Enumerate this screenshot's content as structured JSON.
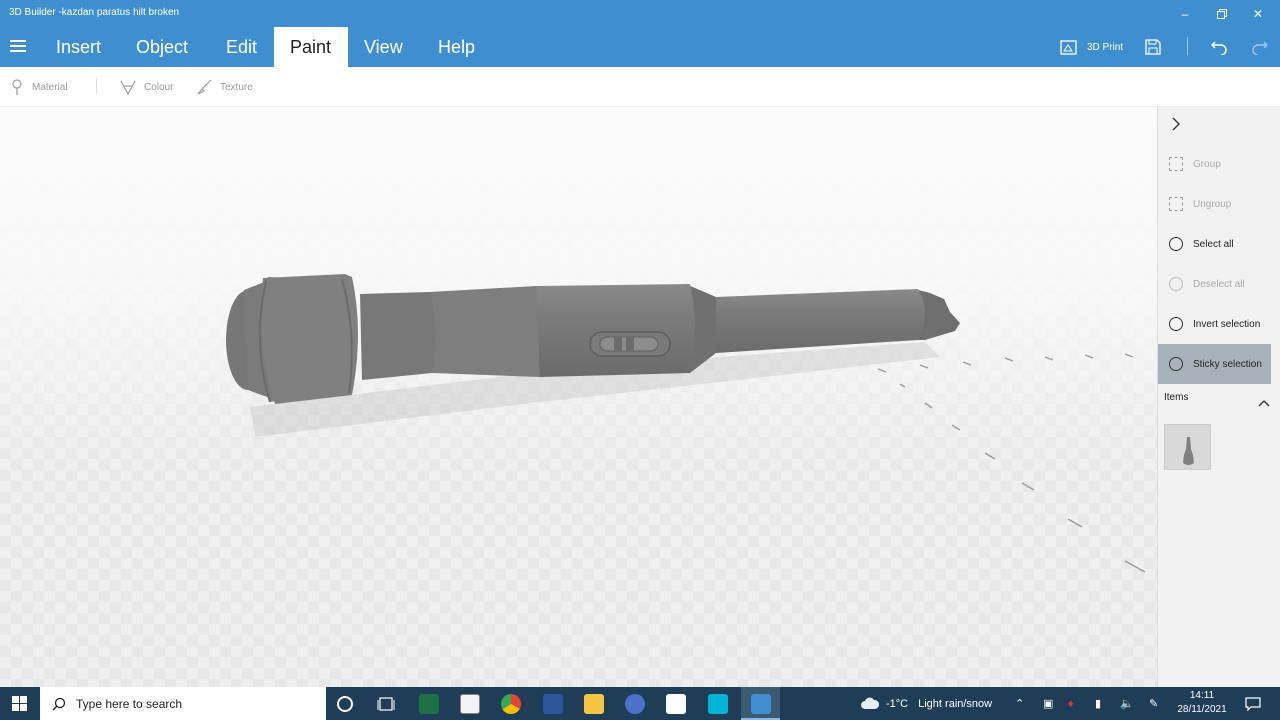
{
  "window": {
    "title": "3D Builder -kazdan paratus hilt broken"
  },
  "menu": {
    "tabs": [
      "Insert",
      "Object",
      "Edit",
      "Paint",
      "View",
      "Help"
    ],
    "active": "Paint",
    "print_label": "3D Print"
  },
  "toolbar": {
    "material": "Material",
    "colour": "Colour",
    "texture": "Texture"
  },
  "panel": {
    "items": [
      {
        "label": "Group",
        "state": "disabled"
      },
      {
        "label": "Ungroup",
        "state": "disabled"
      },
      {
        "label": "Select all",
        "state": "enabled"
      },
      {
        "label": "Deselect all",
        "state": "disabled"
      },
      {
        "label": "Invert selection",
        "state": "enabled"
      },
      {
        "label": "Sticky selection",
        "state": "selected"
      }
    ],
    "items_header": "Items"
  },
  "taskbar": {
    "search_placeholder": "Type here to search",
    "weather_temp": "-1°C",
    "weather_text": "Light rain/snow",
    "time": "14:11",
    "date": "28/11/2021"
  },
  "colors": {
    "accent": "#3f8fd0",
    "taskbar": "#1f3d57",
    "model": "#7d7d7d"
  }
}
